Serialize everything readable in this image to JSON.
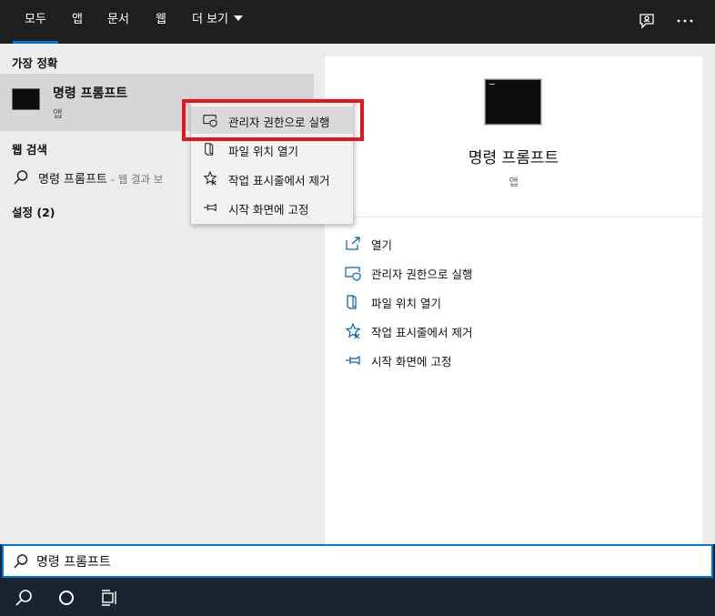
{
  "tabs": [
    {
      "label": "모두",
      "active": true
    },
    {
      "label": "앱"
    },
    {
      "label": "문서"
    },
    {
      "label": "웹"
    },
    {
      "label": "더 보기"
    }
  ],
  "top_icons": [
    "feedback-icon",
    "more-icon"
  ],
  "left": {
    "best_match_heading": "가장 정확",
    "best_match": {
      "name": "명령 프롬프트",
      "type": "앱"
    },
    "web_heading": "웹 검색",
    "web_result": {
      "text": "명령 프롬프트",
      "hint": "- 웹 결과 보"
    },
    "settings_heading": "설정 (2)"
  },
  "context_menu": [
    {
      "label": "관리자 권한으로 실행",
      "icon": "shield-icon",
      "highlighted": true
    },
    {
      "label": "파일 위치 열기",
      "icon": "file-location-icon"
    },
    {
      "label": "작업 표시줄에서 제거",
      "icon": "unpin-taskbar-icon"
    },
    {
      "label": "시작 화면에 고정",
      "icon": "pin-icon"
    }
  ],
  "right": {
    "title": "명령 프롬프트",
    "subtitle": "앱",
    "actions": [
      {
        "label": "열기",
        "icon": "open-icon"
      },
      {
        "label": "관리자 권한으로 실행",
        "icon": "shield-icon"
      },
      {
        "label": "파일 위치 열기",
        "icon": "file-location-icon"
      },
      {
        "label": "작업 표시줄에서 제거",
        "icon": "unpin-taskbar-icon"
      },
      {
        "label": "시작 화면에 고정",
        "icon": "pin-icon"
      }
    ]
  },
  "search": {
    "value": "명령 프롬프트"
  },
  "taskbar_icons": [
    "search-icon",
    "cortana-icon",
    "task-view-icon"
  ],
  "colors": {
    "accent": "#0078d7",
    "highlight_box": "#e2161d",
    "tab_bar": "#1f1f1f",
    "taskbar": "#1b2230"
  }
}
